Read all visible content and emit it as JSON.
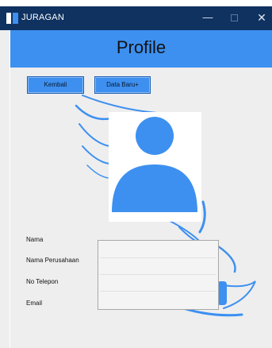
{
  "window": {
    "title": "JURAGAN",
    "minimize_glyph": "—",
    "close_glyph": "✕"
  },
  "header": {
    "title": "Profile"
  },
  "toolbar": {
    "back_label": "Kembali",
    "new_label": "Data Baru+"
  },
  "avatar": {
    "icon": "user-icon",
    "color": "#3d90f0"
  },
  "form": {
    "fields": [
      {
        "label": "Nama",
        "value": ""
      },
      {
        "label": "Nama Perusahaan",
        "value": ""
      },
      {
        "label": "No Telepon",
        "value": ""
      },
      {
        "label": "Email",
        "value": ""
      }
    ]
  },
  "colors": {
    "titlebar": "#0f3260",
    "accent": "#3d90f0",
    "background": "#eeeeef"
  }
}
